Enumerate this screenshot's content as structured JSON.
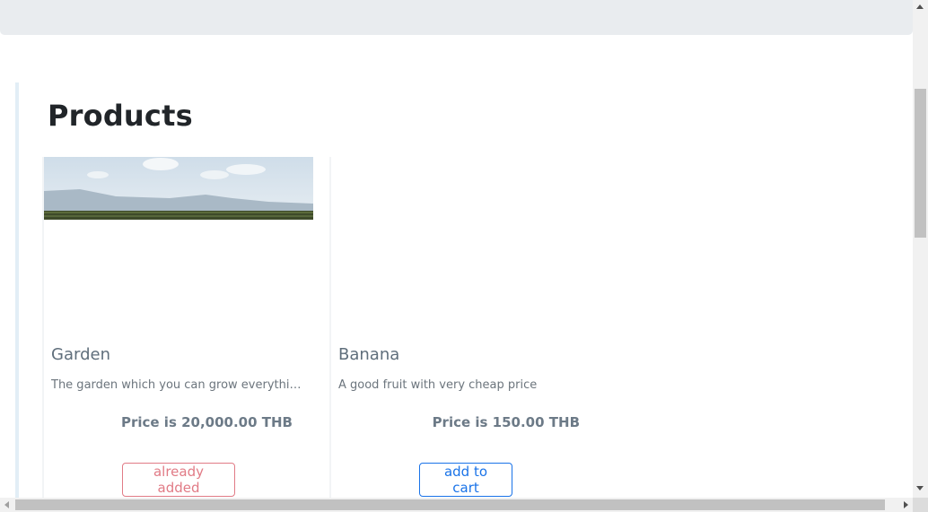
{
  "section": {
    "title": "Products"
  },
  "products": [
    {
      "title": "Garden",
      "description": "The garden which you can grow everything with your hand",
      "price": "Price is 20,000.00 THB",
      "button_label": "already added",
      "button_state": "added"
    },
    {
      "title": "Banana",
      "description": "A good fruit with very cheap price",
      "price": "Price is 150.00 THB",
      "button_label": "add to cart",
      "button_state": "available"
    }
  ],
  "colors": {
    "added_button": "#e17b86",
    "cart_button": "#1a73e8",
    "banner": "#e9ecef"
  }
}
